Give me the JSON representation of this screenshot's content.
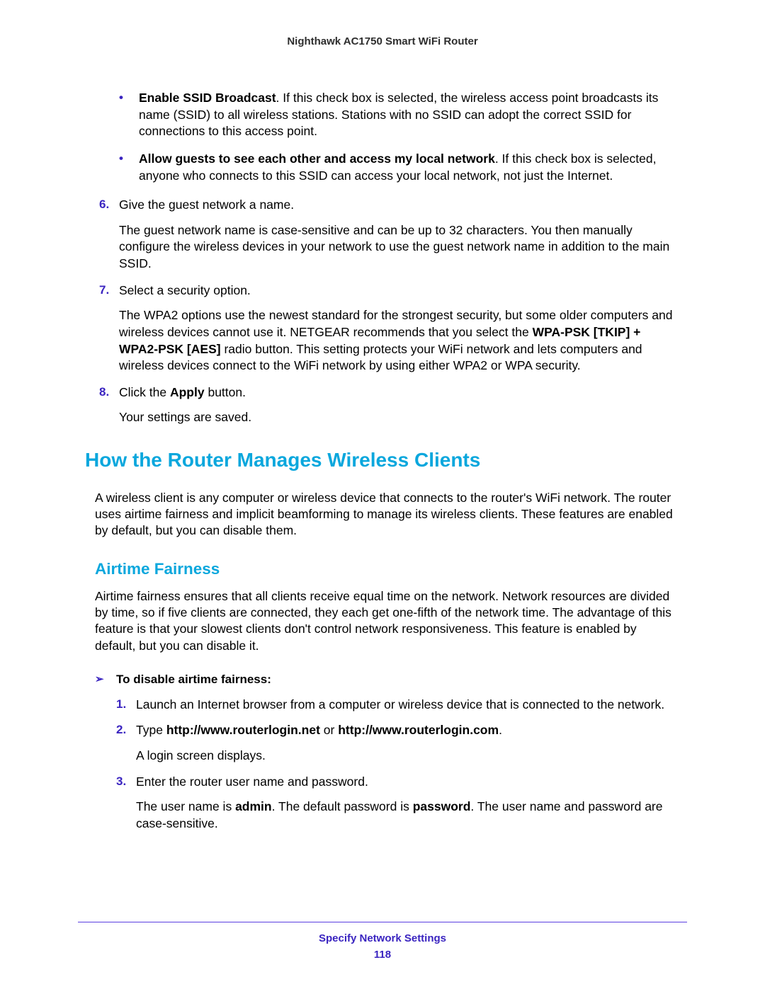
{
  "header": {
    "device": "Nighthawk AC1750 Smart WiFi Router"
  },
  "bullets": [
    {
      "bold": "Enable SSID Broadcast",
      "rest": ". If this check box is selected, the wireless access point broadcasts its name (SSID) to all wireless stations. Stations with no SSID can adopt the correct SSID for connections to this access point."
    },
    {
      "bold": "Allow guests to see each other and access my local network",
      "rest": ". If this check box is selected, anyone who connects to this SSID can access your local network, not just the Internet."
    }
  ],
  "steps": [
    {
      "num": "6.",
      "text": "Give the guest network a name.",
      "body": "The guest network name is case-sensitive and can be up to 32 characters. You then manually configure the wireless devices in your network to use the guest network name in addition to the main SSID."
    },
    {
      "num": "7.",
      "text": "Select a security option.",
      "body_prefix": "The WPA2 options use the newest standard for the strongest security, but some older computers and wireless devices cannot use it. NETGEAR recommends that you select the ",
      "body_bold": "WPA-PSK [TKIP] + WPA2-PSK [AES]",
      "body_suffix": " radio button. This setting protects your WiFi network and lets computers and wireless devices connect to the WiFi network by using either WPA2 or WPA security."
    },
    {
      "num": "8.",
      "text_prefix": "Click the ",
      "text_bold": "Apply",
      "text_suffix": " button.",
      "body": "Your settings are saved."
    }
  ],
  "section": {
    "heading": "How the Router Manages Wireless Clients",
    "intro": "A wireless client is any computer or wireless device that connects to the router's WiFi network. The router uses airtime fairness and implicit beamforming to manage its wireless clients. These features are enabled by default, but you can disable them."
  },
  "subsection": {
    "heading": "Airtime Fairness",
    "intro": "Airtime fairness ensures that all clients receive equal time on the network. Network resources are divided by time, so if five clients are connected, they each get one-fifth of the network time. The advantage of this feature is that your slowest clients don't control network responsiveness. This feature is enabled by default, but you can disable it."
  },
  "procedure": {
    "title": "To disable airtime fairness:",
    "steps": [
      {
        "num": "1.",
        "text": "Launch an Internet browser from a computer or wireless device that is connected to the network."
      },
      {
        "num": "2.",
        "text_prefix": "Type ",
        "bold1": "http://www.routerlogin.net",
        "mid": " or ",
        "bold2": "http://www.routerlogin.com",
        "text_suffix": ".",
        "body": "A login screen displays."
      },
      {
        "num": "3.",
        "text": "Enter the router user name and password.",
        "body_prefix": "The user name is ",
        "body_bold1": "admin",
        "body_mid": ". The default password is ",
        "body_bold2": "password",
        "body_suffix": ". The user name and password are case-sensitive."
      }
    ]
  },
  "footer": {
    "text": "Specify Network Settings",
    "page": "118"
  }
}
